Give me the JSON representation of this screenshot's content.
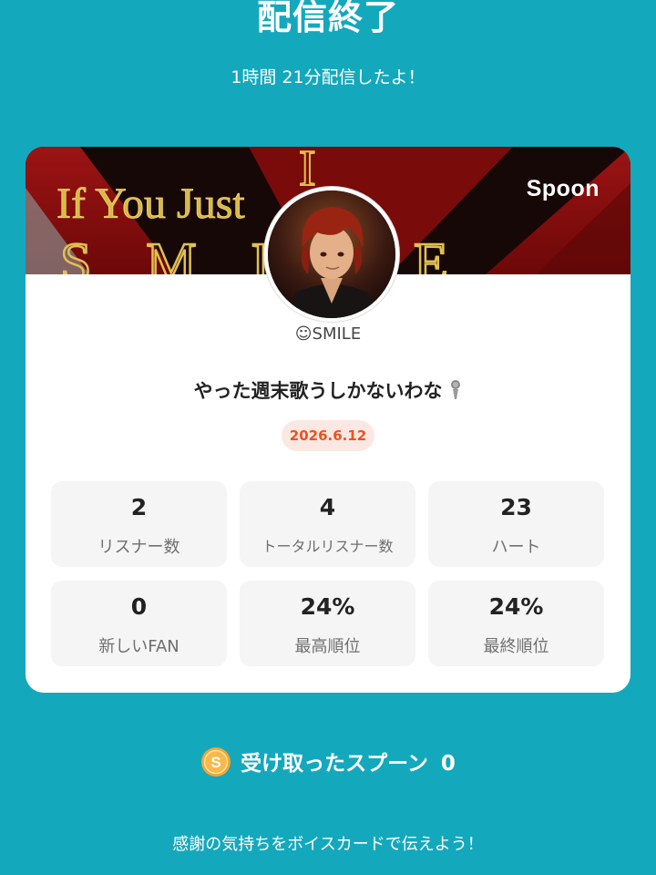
{
  "header": {
    "title": "配信終了",
    "subtitle": "1時間 21分配信したよ！"
  },
  "card": {
    "banner": {
      "text_line1": "If You Just",
      "text_line2": "SMILE",
      "brand": "Spoon"
    },
    "avatar_icon": "profile-illustration",
    "username": "☺SMILE",
    "live_title": "やった週末歌うしかないわな",
    "live_title_icon": "microphone-icon",
    "date": "2026.6.12",
    "stats": [
      {
        "value": "2",
        "label": "リスナー数"
      },
      {
        "value": "4",
        "label": "トータルリスナー数"
      },
      {
        "value": "23",
        "label": "ハート"
      },
      {
        "value": "0",
        "label": "新しいFAN"
      },
      {
        "value": "24%",
        "label": "最高順位"
      },
      {
        "value": "24%",
        "label": "最終順位"
      }
    ]
  },
  "spoons": {
    "icon": "spoon-coin-icon",
    "coin_letter": "S",
    "label": "受け取ったスプーン",
    "count": "0"
  },
  "footer": {
    "text": "感謝の気持ちをボイスカードで伝えよう！"
  },
  "colors": {
    "background": "#14a8bd",
    "card": "#ffffff",
    "accent_orange": "#f0501e",
    "date_badge_bg": "#fbe8e2",
    "stat_tile_bg": "#f5f5f5",
    "coin": "#f6a531"
  }
}
